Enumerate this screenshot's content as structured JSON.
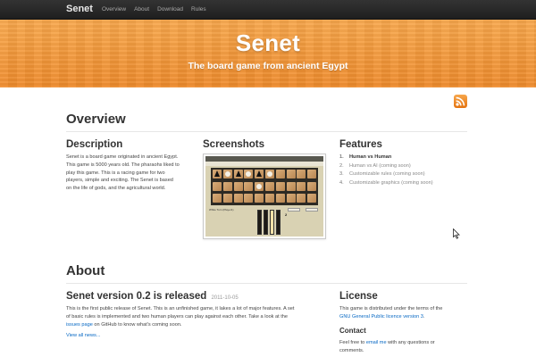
{
  "navbar": {
    "brand": "Senet",
    "links": [
      "Overview",
      "About",
      "Download",
      "Rules"
    ]
  },
  "hero": {
    "title": "Senet",
    "subtitle": "The board game from ancient Egypt"
  },
  "overview": {
    "title": "Overview",
    "description": {
      "heading": "Description",
      "lines": [
        "Senet is a board game originated in ancient Egypt.",
        "This game is 5000 years old. The pharaohs liked to",
        "play this game. This is a racing game for two",
        "players, simple and exciting. The Senet is based",
        "on the life of gods, and the agricultural world."
      ]
    },
    "screenshots": {
      "heading": "Screenshots",
      "status_text": "White Turn (Player1)",
      "score": "2"
    },
    "features": {
      "heading": "Features",
      "items": [
        {
          "num": "1.",
          "label": "Human vs Human"
        },
        {
          "num": "2.",
          "label": "Human vs AI (coming soon)"
        },
        {
          "num": "3.",
          "label": "Customizable rules (coming soon)"
        },
        {
          "num": "4.",
          "label": "Customizable graphics (coming soon)"
        }
      ]
    }
  },
  "about": {
    "title": "About",
    "news": {
      "heading": "Senet version 0.2 is released",
      "date": "2011-10-05",
      "line1": "This is the first public release of Senet. This is an unfinished game, it lakes a lot of major features. A set",
      "line2": "of basic rules is implemented and two human players can play against each other. Take a look at the",
      "link": "issues page",
      "line3_suffix": " on GitHub to know what's coming soon.",
      "view_all": "View all news..."
    },
    "license": {
      "heading": "License",
      "text": "This game is distributed under the terms of the",
      "link": "GNU General Public licence version 3",
      "suffix": "."
    },
    "contact": {
      "heading": "Contact",
      "prefix": "Feel free to ",
      "link": "email me",
      "suffix": " with any questions or",
      "line2": "comments."
    }
  },
  "colors": {
    "hero": "#f59a3b",
    "navbar": "#222222",
    "link": "#0869c4"
  },
  "icons": [
    "rss-icon",
    "mouse-cursor-icon"
  ]
}
